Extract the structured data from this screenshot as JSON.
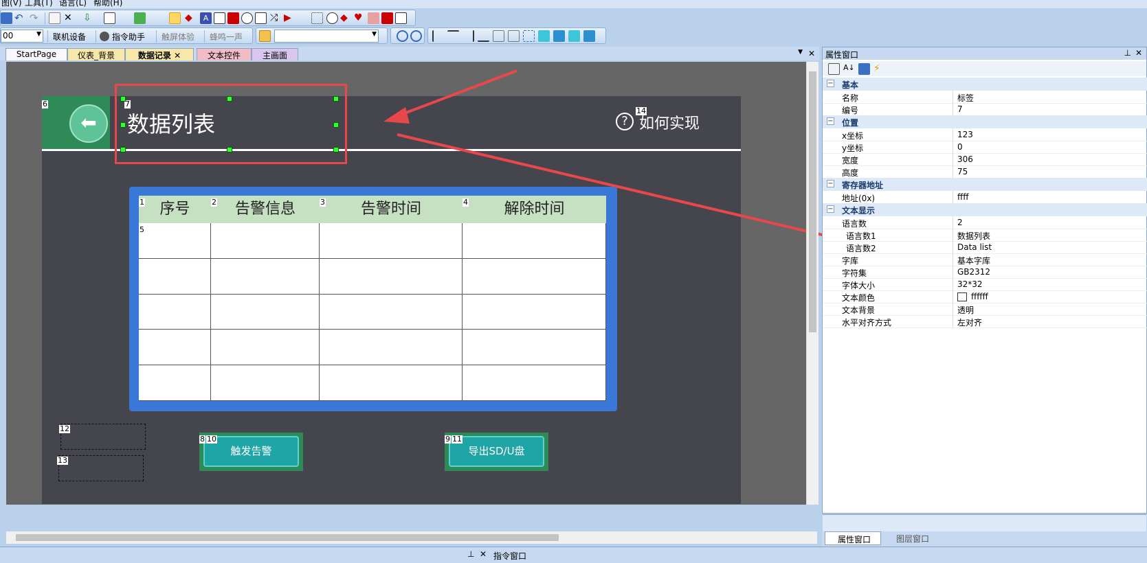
{
  "menu": {
    "items": [
      "图(V)",
      "工具(T)",
      "语言(L)",
      "帮助(H)"
    ]
  },
  "toolbar2": {
    "zoom_value": "00",
    "connect_label": "联机设备",
    "assistant_label": "指令助手",
    "touch_label": "触屏体验",
    "beep_label": "蜂鸣一声"
  },
  "tabs": [
    {
      "label": "StartPage",
      "active": false
    },
    {
      "label": "仪表_背景",
      "active": false
    },
    {
      "label": "数据记录",
      "active": true
    },
    {
      "label": "文本控件",
      "active": false
    },
    {
      "label": "主画面",
      "active": false
    }
  ],
  "design": {
    "header_title": "数据列表",
    "help_label": "如何实现",
    "columns": [
      "序号",
      "告警信息",
      "告警时间",
      "解除时间"
    ],
    "row_count": 5,
    "trigger_button": "触发告警",
    "export_button": "导出SD/U盘",
    "ids": {
      "back": "6",
      "title": "7",
      "help": "14",
      "col1": "1",
      "col2": "2",
      "col3": "3",
      "col4": "4",
      "table": "5",
      "trigger_outer": "8",
      "trigger_inner": "10",
      "export_outer": "9",
      "export_inner": "11",
      "box12": "12",
      "box13": "13"
    },
    "colors": {
      "background": "#45454d",
      "back_panel": "#2e8b57",
      "table_frame": "#3a78d8",
      "header_cells": "#c6e0c2",
      "buttons": "#1fa5a5",
      "annotation": "#e8484c"
    }
  },
  "property_panel": {
    "title": "属性窗口",
    "categories": [
      {
        "label": "基本",
        "rows": [
          {
            "key": "名称",
            "value": "标签"
          },
          {
            "key": "编号",
            "value": "7"
          }
        ]
      },
      {
        "label": "位置",
        "rows": [
          {
            "key": "x坐标",
            "value": "123"
          },
          {
            "key": "y坐标",
            "value": "0"
          },
          {
            "key": "宽度",
            "value": "306"
          },
          {
            "key": "高度",
            "value": "75"
          }
        ]
      },
      {
        "label": "寄存器地址",
        "rows": [
          {
            "key": "地址(0x)",
            "value": "ffff"
          }
        ]
      },
      {
        "label": "文本显示",
        "rows": [
          {
            "key": "语言数",
            "value": "2"
          },
          {
            "key": "语言数1",
            "value": "数据列表"
          },
          {
            "key": "语言数2",
            "value": "Data list"
          },
          {
            "key": "字库",
            "value": "基本字库"
          },
          {
            "key": "字符集",
            "value": "GB2312"
          },
          {
            "key": "字体大小",
            "value": "32*32"
          },
          {
            "key": "文本颜色",
            "value": "ffffff"
          },
          {
            "key": "文本背景",
            "value": "透明"
          },
          {
            "key": "水平对齐方式",
            "value": "左对齐"
          }
        ]
      }
    ],
    "bottom_tabs": [
      "属性窗口",
      "图层窗口"
    ]
  },
  "command_window": {
    "title": "指令窗口"
  }
}
